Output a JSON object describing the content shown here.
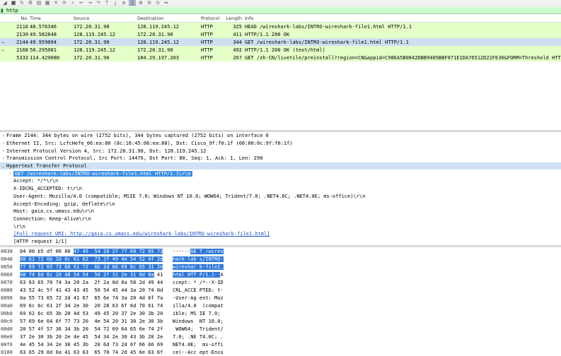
{
  "toolbar": {
    "buttons": [
      "shark-fin-icon",
      "stop-icon",
      "restart-icon",
      "options-icon",
      "open-icon",
      "save-icon",
      "close-icon",
      "reload-icon",
      "find-icon",
      "back-icon",
      "forward-icon",
      "goto-icon",
      "first-icon",
      "last-icon",
      "autoscroll-icon",
      "colorize-icon",
      "zoom-in-icon",
      "zoom-out-icon",
      "zoom-reset-icon",
      "resize-columns-icon"
    ]
  },
  "filter": {
    "value": "http",
    "icon": "bookmark-icon"
  },
  "packet_list": {
    "columns": [
      "No.",
      "Time",
      "Source",
      "Destination",
      "Protocol",
      "Length",
      "Info"
    ],
    "rows": [
      {
        "mark": "",
        "no": "2116",
        "time": "48.576346",
        "src": "172.20.31.90",
        "dst": "128.119.245.12",
        "proto": "HTTP",
        "len": "325",
        "info": "HEAD /wireshark-labs/INTRO-wireshark-file1.html HTTP/1.1",
        "selected": false
      },
      {
        "mark": "",
        "no": "2139",
        "time": "49.582848",
        "src": "128.119.245.12",
        "dst": "172.20.31.90",
        "proto": "HTTP",
        "len": "411",
        "info": "HTTP/1.1 200 OK",
        "selected": false
      },
      {
        "mark": "→",
        "no": "2144",
        "time": "49.959094",
        "src": "172.20.31.90",
        "dst": "128.119.245.12",
        "proto": "HTTP",
        "len": "344",
        "info": "GET /wireshark-labs/INTRO-wireshark-file1.html HTTP/1.1",
        "selected": true
      },
      {
        "mark": "←",
        "no": "2168",
        "time": "50.295081",
        "src": "128.119.245.12",
        "dst": "172.20.31.90",
        "proto": "HTTP",
        "len": "492",
        "info": "HTTP/1.1 200 OK  (text/html)",
        "selected": false
      },
      {
        "mark": "",
        "no": "5333",
        "time": "114.429080",
        "src": "172.20.31.90",
        "dst": "184.29.197.203",
        "proto": "HTTP",
        "len": "267",
        "info": "GET /zh-CN/livetile/preinstall?region=CN&appid=C98EA5B0842DBB9405BBF071E1DA76512D21FE36&FORM=Threshold HTTP/1.1",
        "selected": false
      }
    ]
  },
  "details": [
    {
      "arrow": "›",
      "text": "Frame 2144: 344 bytes on wire (2752 bits), 344 bytes captured (2752 bits) on interface 0",
      "level": 0,
      "sel": false
    },
    {
      "arrow": "›",
      "text": "Ethernet II, Src: LcfcHefe_06:ea:80 (8c:16:45:06:ea:80), Dst: Cisco_9f:f0:1f (00:00:0c:9f:f0:1f)",
      "level": 0,
      "sel": false
    },
    {
      "arrow": "›",
      "text": "Internet Protocol Version 4, Src: 172.20.31.90, Dst: 128.119.245.12",
      "level": 0,
      "sel": false
    },
    {
      "arrow": "›",
      "text": "Transmission Control Protocol, Src Port: 14476, Dst Port: 80, Seq: 1, Ack: 1, Len: 290",
      "level": 0,
      "sel": false
    },
    {
      "arrow": "⌄",
      "text": "Hypertext Transfer Protocol",
      "level": 0,
      "sel": true
    },
    {
      "arrow": "›",
      "text": "GET /wireshark-labs/INTRO-wireshark-file1.html HTTP/1.1\\r\\n",
      "level": 1,
      "sel": false,
      "hl": true
    },
    {
      "arrow": "",
      "text": "Accept: */*\\r\\n",
      "level": 1,
      "sel": false
    },
    {
      "arrow": "",
      "text": "X-IDCRL_ACCEPTED: t\\r\\n",
      "level": 1,
      "sel": false
    },
    {
      "arrow": "",
      "text": "User-Agent: Mozilla/4.0 (compatible; MSIE 7.0; Windows NT 10.0; WOW64; Trident/7.0; .NET4.0C; .NET4.0E; ms-office)\\r\\n",
      "level": 1,
      "sel": false
    },
    {
      "arrow": "",
      "text": "Accept-Encoding: gzip, deflate\\r\\n",
      "level": 1,
      "sel": false
    },
    {
      "arrow": "",
      "text": "Host: gaia.cs.umass.edu\\r\\n",
      "level": 1,
      "sel": false
    },
    {
      "arrow": "",
      "text": "Connection: Keep-Alive\\r\\n",
      "level": 1,
      "sel": false
    },
    {
      "arrow": "",
      "text": "\\r\\n",
      "level": 1,
      "sel": false
    },
    {
      "arrow": "",
      "text": "[Full request URI: http://gaia.cs.umass.edu/wireshark-labs/INTRO-wireshark-file1.html]",
      "level": 1,
      "sel": false,
      "link": true
    },
    {
      "arrow": "",
      "text": "[HTTP request 1/1]",
      "level": 1,
      "sel": false
    }
  ],
  "bytes": [
    {
      "off": "0030",
      "pre_hex": "04 00 b5 df 00 00 ",
      "hl_hex": "47 45  54 20 2f 77 69 72 65 73",
      "post_hex": "",
      "pre_asc": "······",
      "hl_asc": "GE T /wires",
      "post_asc": ""
    },
    {
      "off": "0040",
      "pre_hex": "",
      "hl_hex": "68 61 72 6b 2d 6c 61 62  73 2f 49 4e 54 52 4f 2d",
      "post_hex": "",
      "pre_asc": "",
      "hl_asc": "hark-lab s/INTRO-",
      "post_asc": ""
    },
    {
      "off": "0050",
      "pre_hex": "",
      "hl_hex": "77 69 72 65 73 68 61 72  6b 2d 66 69 6c 65 31 2e",
      "post_hex": "",
      "pre_asc": "",
      "hl_asc": "wireshar k-file1.",
      "post_asc": ""
    },
    {
      "off": "0060",
      "pre_hex": "",
      "hl_hex": "68 74 6d 6c 20 48 54 54  50 2f 31 2e 31 0d 0a",
      "post_hex": " 41",
      "pre_asc": "",
      "hl_asc": "html HTT P/1.1··",
      "post_asc": "A"
    },
    {
      "off": "0070",
      "pre_hex": "63 63 65 70 74 3a 20 2a  2f 2a 0d 0a 58 2d 49 44",
      "hl_hex": "",
      "post_hex": "",
      "pre_asc": "ccept: * /*··X-ID",
      "hl_asc": "",
      "post_asc": ""
    },
    {
      "off": "0080",
      "pre_hex": "43 52 4c 5f 41 43 43 45  50 54 45 44 3a 20 74 0d",
      "hl_hex": "",
      "post_hex": "",
      "pre_asc": "CRL_ACCE PTED: t·",
      "hl_asc": "",
      "post_asc": ""
    },
    {
      "off": "0090",
      "pre_hex": "0a 55 73 65 72 2d 41 67  65 6e 74 3a 20 4d 6f 7a",
      "hl_hex": "",
      "post_hex": "",
      "pre_asc": "·User-Ag ent: Moz",
      "hl_asc": "",
      "post_asc": ""
    },
    {
      "off": "00a0",
      "pre_hex": "69 6c 6c 61 2f 34 2e 30  20 28 63 6f 6d 70 61 74",
      "hl_hex": "",
      "post_hex": "",
      "pre_asc": "illa/4.0  (compat",
      "hl_asc": "",
      "post_asc": ""
    },
    {
      "off": "00b0",
      "pre_hex": "69 62 6c 65 3b 20 4d 53  49 45 20 37 2e 30 3b 20",
      "hl_hex": "",
      "post_hex": "",
      "pre_asc": "ible; MS IE 7.0; ",
      "hl_asc": "",
      "post_asc": ""
    },
    {
      "off": "00c0",
      "pre_hex": "57 69 6e 64 6f 77 73 20  4e 54 20 31 30 2e 30 3b",
      "hl_hex": "",
      "post_hex": "",
      "pre_asc": "Windows  NT 10.0;",
      "hl_asc": "",
      "post_asc": ""
    },
    {
      "off": "00d0",
      "pre_hex": "20 57 4f 57 36 34 3b 20  54 72 69 64 65 6e 74 2f",
      "hl_hex": "",
      "post_hex": "",
      "pre_asc": " WOW64;  Trident/",
      "hl_asc": "",
      "post_asc": ""
    },
    {
      "off": "00e0",
      "pre_hex": "37 2e 30 3b 20 2e 4e 45  54 34 2e 30 43 3b 20 2e",
      "hl_hex": "",
      "post_hex": "",
      "pre_asc": "7.0; .NE T4.0C; .",
      "hl_asc": "",
      "post_asc": ""
    },
    {
      "off": "00f0",
      "pre_hex": "4e 45 54 34 2e 30 45 3b  20 6d 73 2d 6f 66 66 69",
      "hl_hex": "",
      "post_hex": "",
      "pre_asc": "NET4.0E;  ms-offi",
      "hl_asc": "",
      "post_asc": ""
    },
    {
      "off": "0100",
      "pre_hex": "63 65 29 0d 0a 41 63 63  65 70 74 2d 45 6e 63 6f",
      "hl_hex": "",
      "post_hex": "",
      "pre_asc": "ce)··Acc ept-Enco",
      "hl_asc": "",
      "post_asc": ""
    }
  ]
}
